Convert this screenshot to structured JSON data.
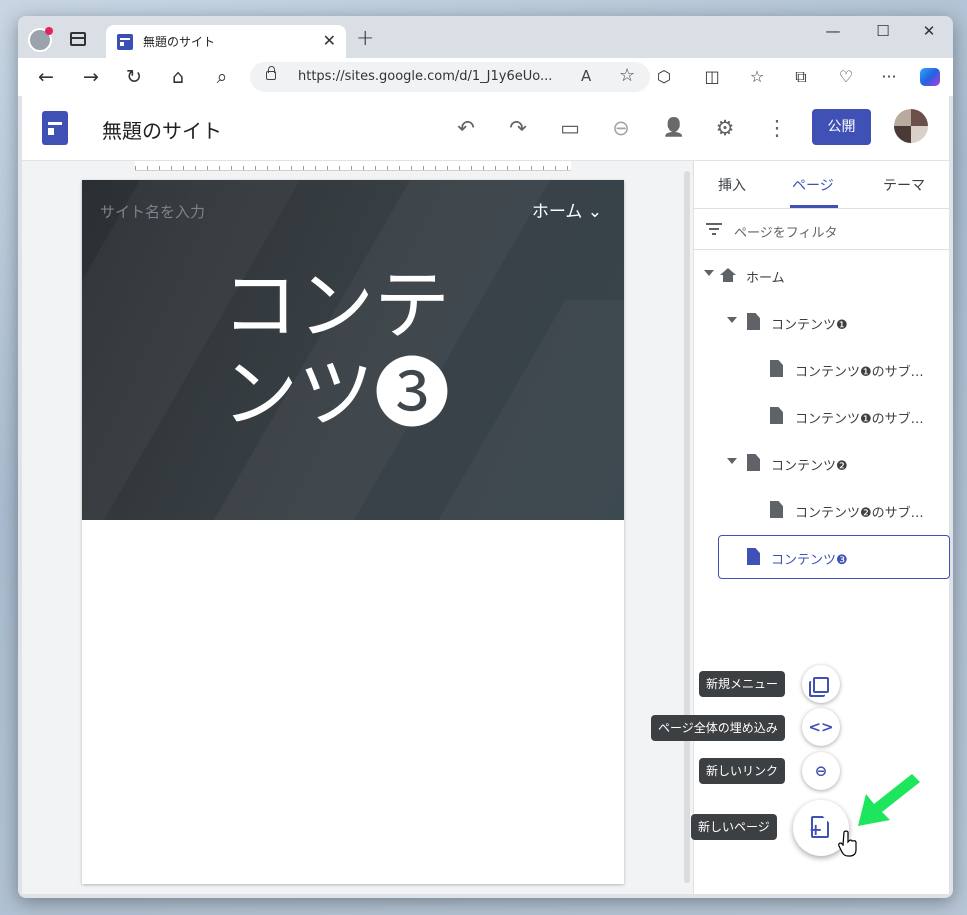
{
  "browser": {
    "tab_title": "無題のサイト",
    "tab_close": "✕",
    "new_tab": "+",
    "minimize": "—",
    "maximize": "☐",
    "close": "✕",
    "url": "https://sites.google.com/d/1_J1y6eUo...",
    "read_aloud": "A",
    "favorite": "☆",
    "nav": {
      "back": "←",
      "forward": "→",
      "reload": "↻",
      "home": "⌂",
      "search": "⌕"
    },
    "toolbar": {
      "extensions": "⬡",
      "split": "◫",
      "favorites": "☆",
      "collections": "⧉",
      "health": "♡",
      "more": "···"
    }
  },
  "appbar": {
    "site_title": "無題のサイト",
    "publish_label": "公開",
    "undo": "↶",
    "redo": "↷",
    "preview": "▭",
    "link": "⊖",
    "share": "👤",
    "settings": "⚙",
    "more": "⋮"
  },
  "page": {
    "site_name_placeholder": "サイト名を入力",
    "home_nav": "ホーム ⌄",
    "title": "コンテンツ❸"
  },
  "panel": {
    "tabs": [
      "挿入",
      "ページ",
      "テーマ"
    ],
    "active_tab": "ページ",
    "filter_placeholder": "ページをフィルタ",
    "tree": [
      {
        "label": "ホーム",
        "level": 0,
        "icon": "home-icon",
        "expanded": true
      },
      {
        "label": "コンテンツ❶",
        "level": 1,
        "icon": "page-icon",
        "expanded": true
      },
      {
        "label": "コンテンツ❶のサブ…",
        "level": 2,
        "icon": "page-icon"
      },
      {
        "label": "コンテンツ❶のサブ…",
        "level": 2,
        "icon": "page-icon"
      },
      {
        "label": "コンテンツ❷",
        "level": 1,
        "icon": "page-icon",
        "expanded": true
      },
      {
        "label": "コンテンツ❷のサブ…",
        "level": 2,
        "icon": "page-icon"
      },
      {
        "label": "コンテンツ❸",
        "level": 1,
        "icon": "page-icon",
        "selected": true
      }
    ]
  },
  "fab_menu": {
    "new_menu": "新規メニュー",
    "embed_page": "ページ全体の埋め込み",
    "new_link": "新しいリンク",
    "new_page": "新しいページ",
    "embed_symbol": "<>",
    "link_symbol": "⊖",
    "plus": "+"
  },
  "colors": {
    "accent": "#3f51b5",
    "banner": "#353c41",
    "arrow": "#1de55c"
  }
}
